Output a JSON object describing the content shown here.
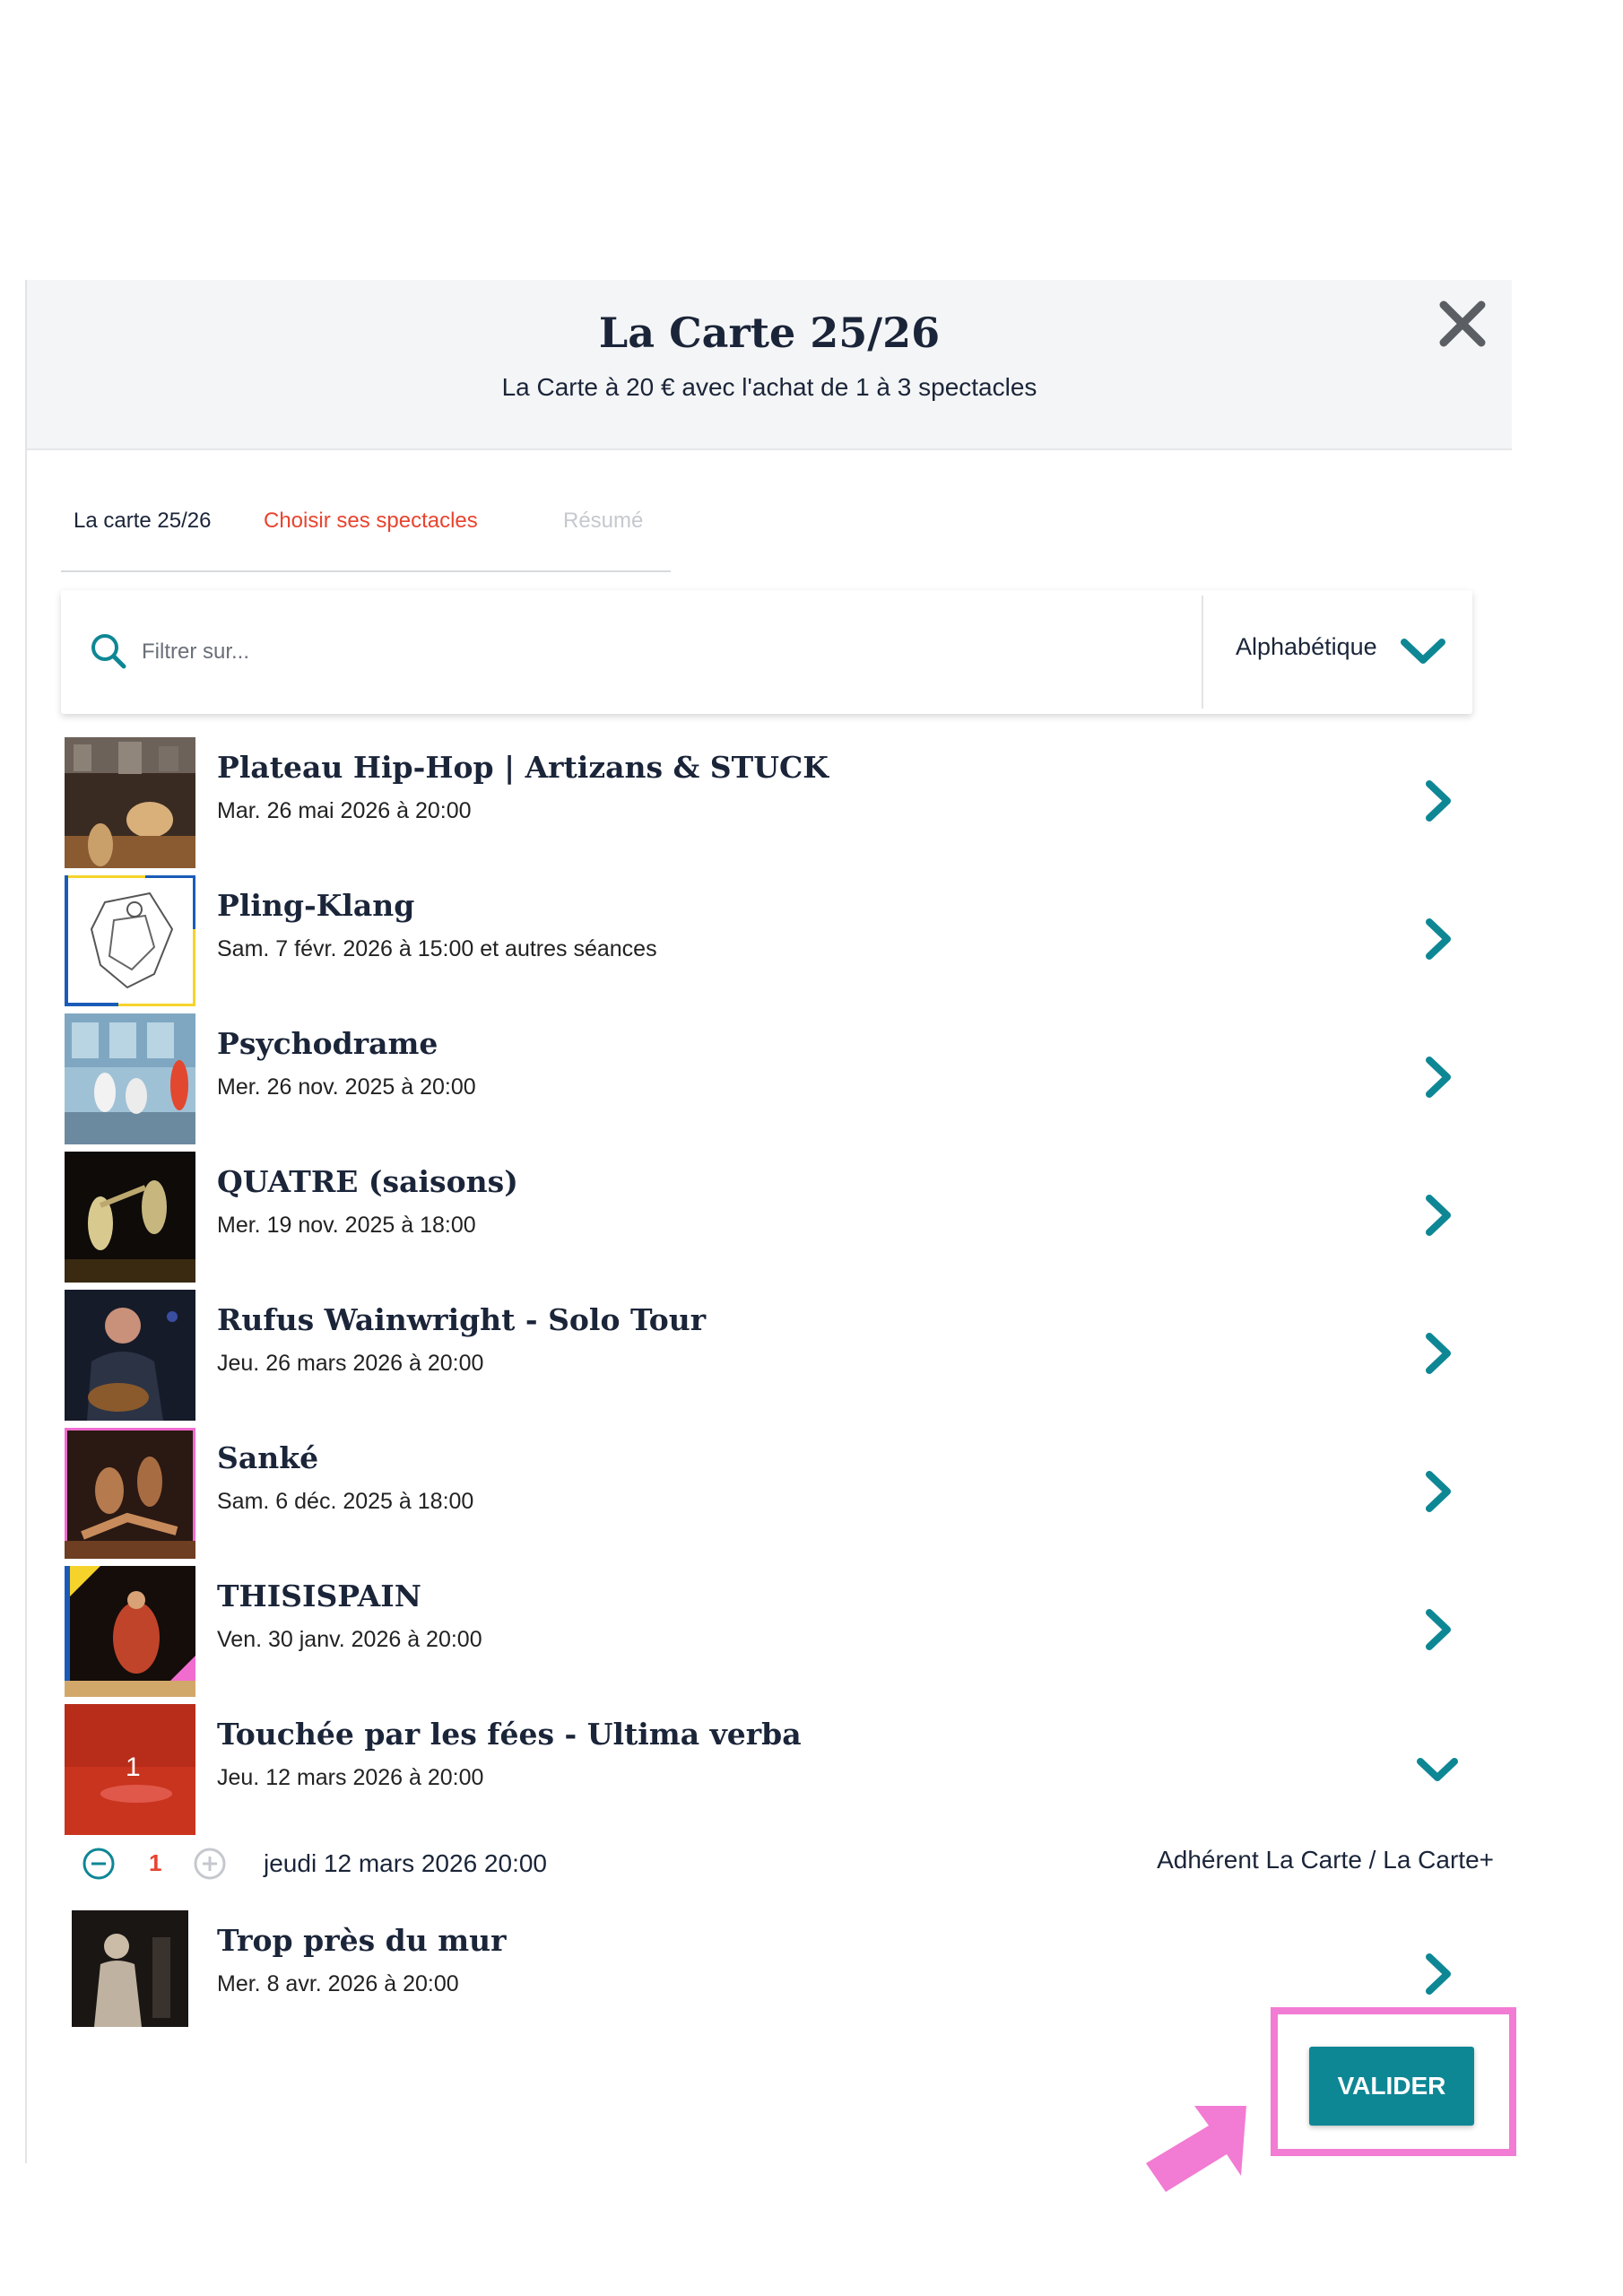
{
  "modal": {
    "title": "La Carte 25/26",
    "subtitle": "La Carte à 20 € avec l'achat de 1 à 3 spectacles",
    "close_icon": "close-icon"
  },
  "tabs": [
    {
      "label": "La carte 25/26",
      "state": "done"
    },
    {
      "label": "Choisir ses spectacles",
      "state": "active"
    },
    {
      "label": "Résumé",
      "state": "disabled"
    }
  ],
  "filter": {
    "placeholder": "Filtrer sur...",
    "value": "",
    "sort_selected": "Alphabétique"
  },
  "shows": [
    {
      "title": "Plateau Hip-Hop | Artizans & STUCK",
      "date": "Mar. 26 mai 2026 à 20:00",
      "expanded": false
    },
    {
      "title": "Pling-Klang",
      "date": "Sam. 7 févr. 2026 à 15:00 et autres séances",
      "expanded": false
    },
    {
      "title": "Psychodrame",
      "date": "Mer. 26 nov. 2025 à 20:00",
      "expanded": false
    },
    {
      "title": "QUATRE (saisons)",
      "date": "Mer. 19 nov. 2025 à 18:00",
      "expanded": false
    },
    {
      "title": "Rufus Wainwright - Solo Tour",
      "date": "Jeu. 26 mars 2026 à 20:00",
      "expanded": false
    },
    {
      "title": "Sanké",
      "date": "Sam. 6 déc. 2025 à 18:00",
      "expanded": false
    },
    {
      "title": "THISISPAIN",
      "date": "Ven. 30 janv. 2026 à 20:00",
      "expanded": false
    },
    {
      "title": "Touchée par les fées - Ultima verba",
      "date": "Jeu. 12 mars 2026 à 20:00",
      "expanded": true,
      "badge": "1"
    },
    {
      "title": "Trop près du mur",
      "date": "Mer. 8 avr. 2026 à 20:00",
      "expanded": false
    }
  ],
  "session": {
    "quantity": "1",
    "date": "jeudi 12 mars 2026 20:00",
    "rate": "Adhérent La Carte / La Carte+"
  },
  "actions": {
    "validate_label": "VALIDER"
  },
  "colors": {
    "accent": "#e8442f",
    "teal": "#0e8795",
    "highlight": "#f27bd3"
  }
}
